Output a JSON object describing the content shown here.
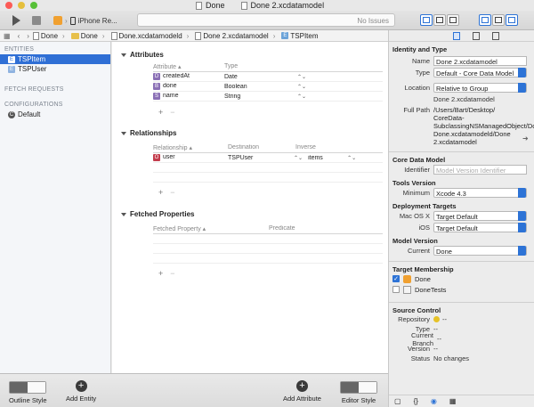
{
  "window": {
    "tabs": [
      {
        "label": "Done"
      },
      {
        "label": "Done 2.xcdatamodel"
      }
    ]
  },
  "toolbar": {
    "scheme_target": "iPhone Re...",
    "activity_status": "No Issues"
  },
  "jumpbar": {
    "crumbs": [
      {
        "label": "Done"
      },
      {
        "label": "Done"
      },
      {
        "label": "Done.xcdatamodeld"
      },
      {
        "label": "Done 2.xcdatamodel"
      },
      {
        "label": "TSPItem"
      }
    ]
  },
  "outline": {
    "entities_header": "ENTITIES",
    "entities": [
      {
        "label": "TSPItem",
        "badge": "E"
      },
      {
        "label": "TSPUser",
        "badge": "E"
      }
    ],
    "fetch_header": "FETCH REQUESTS",
    "config_header": "CONFIGURATIONS",
    "configs": [
      {
        "label": "Default",
        "badge": "C"
      }
    ]
  },
  "editor": {
    "attributes": {
      "title": "Attributes",
      "col_attribute": "Attribute",
      "col_type": "Type",
      "rows": [
        {
          "badge": "D",
          "name": "createdAt",
          "type": "Date"
        },
        {
          "badge": "B",
          "name": "done",
          "type": "Boolean"
        },
        {
          "badge": "S",
          "name": "name",
          "type": "String"
        }
      ]
    },
    "relationships": {
      "title": "Relationships",
      "col_relationship": "Relationship",
      "col_destination": "Destination",
      "col_inverse": "Inverse",
      "rows": [
        {
          "badge": "O",
          "name": "user",
          "destination": "TSPUser",
          "inverse": "items"
        }
      ]
    },
    "fetched": {
      "title": "Fetched Properties",
      "col_fetched": "Fetched Property",
      "col_predicate": "Predicate"
    },
    "plus": "+",
    "minus": "−"
  },
  "inspector": {
    "identity": {
      "title": "Identity and Type",
      "name_label": "Name",
      "name_value": "Done 2.xcdatamodel",
      "type_label": "Type",
      "type_value": "Default - Core Data Model",
      "location_label": "Location",
      "location_value": "Relative to Group",
      "location_file": "Done 2.xcdatamodel",
      "fullpath_label": "Full Path",
      "fullpath_lines": [
        "/Users/Bart/Desktop/",
        "CoreData-",
        "SubclassingNSManagedObject/Done/",
        "Done.xcdatamodeld/Done",
        "2.xcdatamodel"
      ]
    },
    "core_data": {
      "title": "Core Data Model",
      "identifier_label": "Identifier",
      "identifier_placeholder": "Model Version Identifier"
    },
    "tools": {
      "title": "Tools Version",
      "minimum_label": "Minimum",
      "minimum_value": "Xcode 4.3"
    },
    "deployment": {
      "title": "Deployment Targets",
      "macos_label": "Mac OS X",
      "macos_value": "Target Default",
      "ios_label": "iOS",
      "ios_value": "Target Default"
    },
    "model_version": {
      "title": "Model Version",
      "current_label": "Current",
      "current_value": "Done"
    },
    "membership": {
      "title": "Target Membership",
      "items": [
        {
          "label": "Done",
          "checked": true
        },
        {
          "label": "DoneTests",
          "checked": false
        }
      ]
    },
    "source": {
      "title": "Source Control",
      "repository_label": "Repository",
      "repository_value": "--",
      "type_label": "Type",
      "type_value": "--",
      "branch_label": "Current Branch",
      "branch_value": "--",
      "version_label": "Version",
      "version_value": "--",
      "status_label": "Status",
      "status_value": "No changes"
    }
  },
  "bottombar": {
    "outline_style": "Outline Style",
    "add_entity": "Add Entity",
    "add_attribute": "Add Attribute",
    "editor_style": "Editor Style"
  },
  "colors": {
    "selection": "#2f6fd5",
    "accent": "#2d73d6"
  }
}
